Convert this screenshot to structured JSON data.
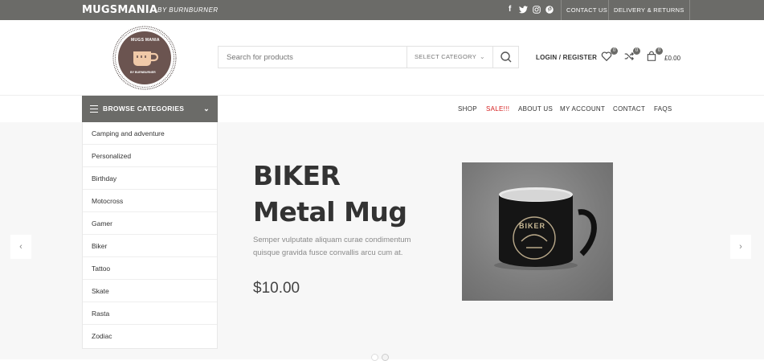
{
  "topbar": {
    "brand": "MUGSMANIA",
    "brand_sub": "BY BURNBURNER",
    "social": {
      "facebook": "f",
      "twitter": "t",
      "instagram": "ig",
      "pinterest": "p"
    },
    "links": [
      "CONTACT US",
      "DELIVERY & RETURNS"
    ]
  },
  "header": {
    "search_placeholder": "Search for products",
    "category_select": "SELECT CATEGORY",
    "login_register": "LOGIN / REGISTER",
    "wishlist_count": "0",
    "compare_count": "0",
    "cart_count": "0",
    "cart_total": "£0.00",
    "logo_text_top": "MUGS MANIA",
    "logo_text_bottom": "BY BURNBURNER"
  },
  "nav": {
    "browse_label": "BROWSE CATEGORIES",
    "items": [
      "SHOP",
      "SALE!!!",
      "ABOUT US",
      "MY ACCOUNT",
      "CONTACT",
      "FAQS"
    ]
  },
  "categories": [
    "Camping and adventure",
    "Personalized",
    "Birthday",
    "Motocross",
    "Gamer",
    "Biker",
    "Tattoo",
    "Skate",
    "Rasta",
    "Zodiac"
  ],
  "slide": {
    "title_line1": "BIKER",
    "title_line2": "Metal Mug",
    "description": "Semper vulputate aliquam curae condimentum quisque gravida fusce convallis arcu cum at.",
    "price": "$10.00",
    "mug_print": "BIKER"
  },
  "colors": {
    "topbar": "#6b6b68",
    "sale": "#d51d1d",
    "hero_bg": "#f7f7f7"
  },
  "icons": {
    "prev": "chevron-left-icon",
    "next": "chevron-right-icon",
    "search": "search-icon",
    "wishlist": "heart-icon",
    "compare": "shuffle-icon",
    "cart": "bag-icon"
  }
}
